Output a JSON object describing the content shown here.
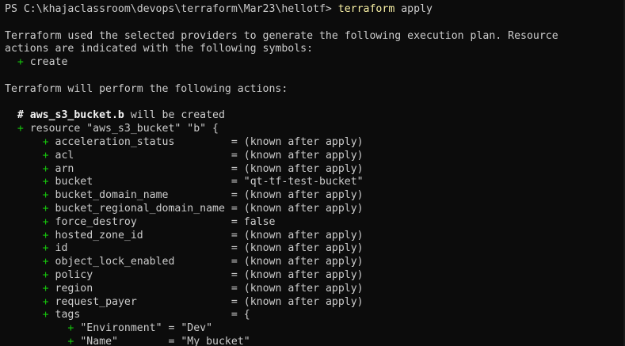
{
  "terminal": {
    "colors": {
      "background": "#0c0c0c",
      "text": "#cccccc",
      "command": "#f9f1a5",
      "plus": "#16c60c",
      "bold": "#f2f2f2"
    },
    "prompt": "PS C:\\khajaclassroom\\devops\\terraform\\Mar23\\hellotf> ",
    "command": "terraform",
    "command_args": " apply",
    "intro_line1": "Terraform used the selected providers to generate the following execution plan. Resource",
    "intro_line2": "actions are indicated with the following symbols:",
    "symbol_plus": "+",
    "symbol_label": " create",
    "perform_line": "Terraform will perform the following actions:",
    "comment_hash": "# ",
    "comment_resource": "aws_s3_bucket.b",
    "comment_suffix": " will be created",
    "resource_line": " resource \"aws_s3_bucket\" \"b\" {",
    "attributes": [
      {
        "name": "acceleration_status",
        "value": "(known after apply)"
      },
      {
        "name": "acl",
        "value": "(known after apply)"
      },
      {
        "name": "arn",
        "value": "(known after apply)"
      },
      {
        "name": "bucket",
        "value": "\"qt-tf-test-bucket\""
      },
      {
        "name": "bucket_domain_name",
        "value": "(known after apply)"
      },
      {
        "name": "bucket_regional_domain_name",
        "value": "(known after apply)"
      },
      {
        "name": "force_destroy",
        "value": "false"
      },
      {
        "name": "hosted_zone_id",
        "value": "(known after apply)"
      },
      {
        "name": "id",
        "value": "(known after apply)"
      },
      {
        "name": "object_lock_enabled",
        "value": "(known after apply)"
      },
      {
        "name": "policy",
        "value": "(known after apply)"
      },
      {
        "name": "region",
        "value": "(known after apply)"
      },
      {
        "name": "request_payer",
        "value": "(known after apply)"
      },
      {
        "name": "tags",
        "value": "{"
      }
    ],
    "tags": [
      {
        "key": "\"Environment\"",
        "value": "\"Dev\""
      },
      {
        "key": "\"Name\"",
        "value": "\"My bucket\""
      }
    ]
  }
}
